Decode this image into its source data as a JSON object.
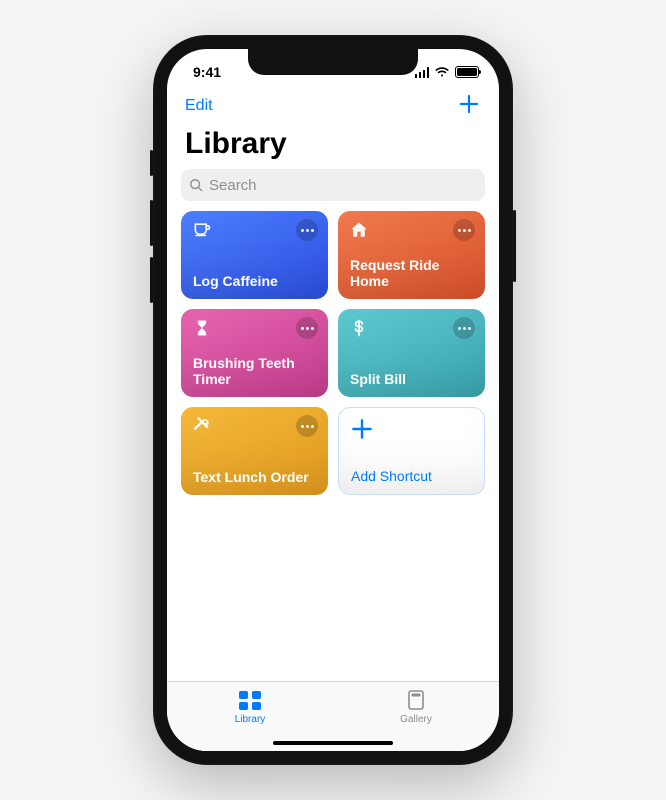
{
  "statusbar": {
    "time": "9:41"
  },
  "navbar": {
    "edit_label": "Edit"
  },
  "header": {
    "title": "Library"
  },
  "search": {
    "placeholder": "Search"
  },
  "shortcuts": [
    {
      "title": "Log Caffeine",
      "color_a": "#4d7eff",
      "color_b": "#2c4fe0",
      "icon": "cup"
    },
    {
      "title": "Request Ride Home",
      "color_a": "#f07a4f",
      "color_b": "#d9522b",
      "icon": "home"
    },
    {
      "title": "Brushing Teeth Timer",
      "color_a": "#e765b0",
      "color_b": "#c43e8f",
      "icon": "hourglass"
    },
    {
      "title": "Split Bill",
      "color_a": "#5fc9d1",
      "color_b": "#3aa5ae",
      "icon": "dollar"
    },
    {
      "title": "Text Lunch Order",
      "color_a": "#f5b93a",
      "color_b": "#e09a1f",
      "icon": "utensils"
    }
  ],
  "add_tile": {
    "label": "Add Shortcut"
  },
  "tabs": {
    "library": "Library",
    "gallery": "Gallery"
  }
}
